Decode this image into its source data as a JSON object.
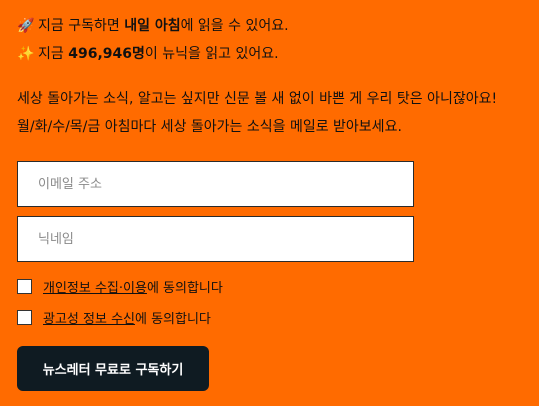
{
  "intro": {
    "line1": {
      "icon": "rocket-icon",
      "emoji": "🚀",
      "prefix": "지금 구독하면 ",
      "emphasis": "내일 아침",
      "suffix": "에 읽을 수 있어요."
    },
    "line2": {
      "icon": "sparkles-icon",
      "emoji": "✨",
      "prefix": "지금 ",
      "emphasis": "496,946명",
      "suffix": "이 뉴닉을 읽고 있어요."
    },
    "desc1": "세상 돌아가는 소식, 알고는 싶지만 신문 볼 새 없이 바쁜 게 우리 탓은 아니잖아요!",
    "desc2": "월/화/수/목/금 아침마다 세상 돌아가는 소식을 메일로 받아보세요."
  },
  "form": {
    "email_placeholder": "이메일 주소",
    "email_value": "",
    "nickname_placeholder": "닉네임",
    "nickname_value": "",
    "consent_privacy": {
      "link": "개인정보 수집·이용",
      "rest": "에 동의합니다"
    },
    "consent_marketing": {
      "link": "광고성 정보 수신",
      "rest": "에 동의합니다"
    },
    "submit_label": "뉴스레터 무료로 구독하기"
  },
  "colors": {
    "background": "#FF6B00",
    "button": "#0F1B22",
    "text": "#111111"
  }
}
